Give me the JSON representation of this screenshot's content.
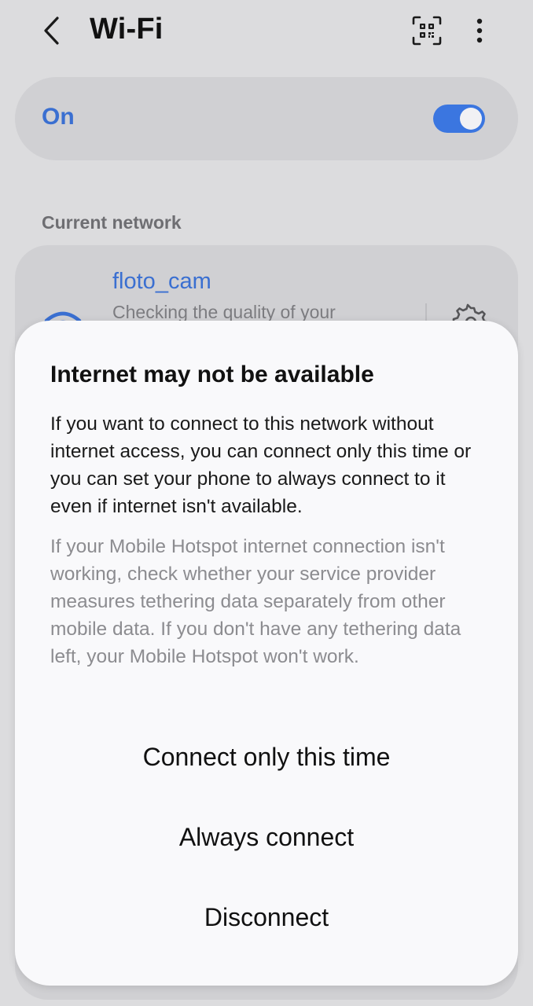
{
  "header": {
    "title": "Wi-Fi",
    "back_icon": "chevron-left-icon",
    "qr_icon": "qr-code-scan-icon",
    "more_icon": "more-vertical-icon"
  },
  "wifi_toggle": {
    "label": "On",
    "state": "on",
    "accent_color": "#3b76e0"
  },
  "current_network": {
    "section_label": "Current network",
    "name": "floto_cam",
    "status": "Checking the quality of your",
    "icon": "wifi-icon",
    "settings_icon": "gear-icon"
  },
  "dialog": {
    "title": "Internet may not be available",
    "body": "If you want to connect to this network without internet access, you can connect only this time or you can set your phone to always connect to it even if internet isn't available.",
    "note": "If your Mobile Hotspot internet connection isn't working, check whether your service provider measures tethering data separately from other mobile data. If you don't have any tethering data left, your Mobile Hotspot won't work.",
    "buttons": {
      "connect_once": "Connect only this time",
      "always_connect": "Always connect",
      "disconnect": "Disconnect"
    }
  }
}
